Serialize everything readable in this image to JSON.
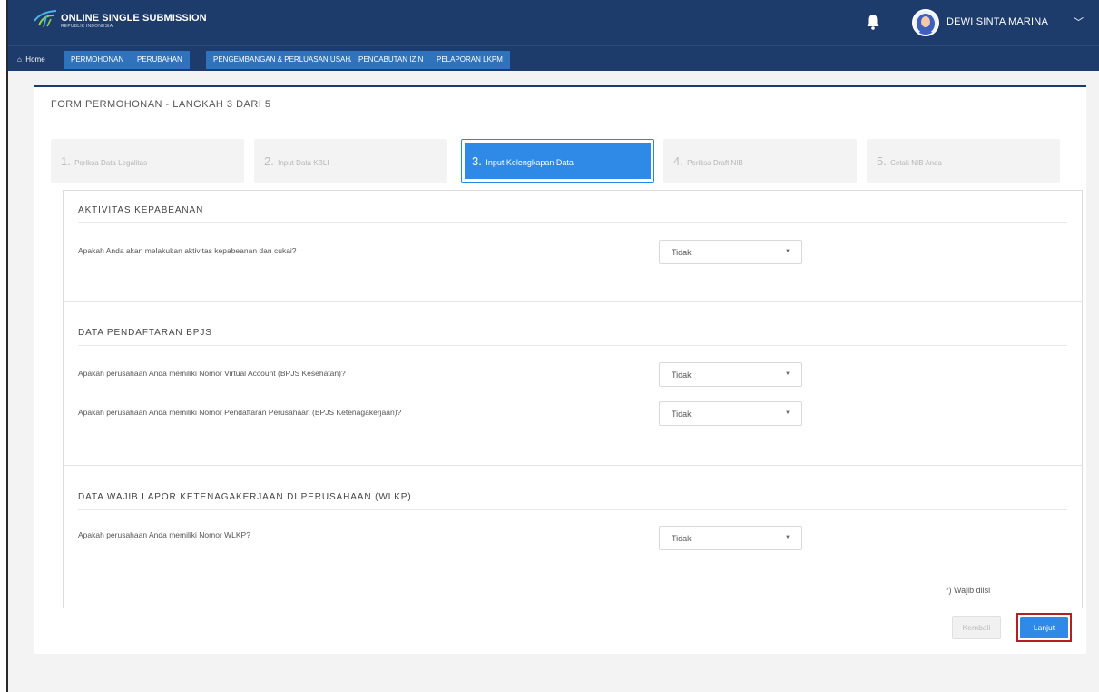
{
  "header": {
    "brand_title": "ONLINE SINGLE SUBMISSION",
    "brand_sub": "REPUBLIK INDONESIA",
    "user_name": "DEWI SINTA MARINA",
    "colors": {
      "primary": "#1d3b6b",
      "accent": "#2f89e6",
      "highlight": "#b41f24"
    }
  },
  "nav": {
    "home": "Home",
    "items": [
      "PERMOHONAN",
      "PERUBAHAN",
      "PENGEMBANGAN & PERLUASAN USAHA",
      "PENCABUTAN IZIN",
      "PELAPORAN LKPM"
    ]
  },
  "form": {
    "title": "FORM PERMOHONAN - LANGKAH 3 DARI 5",
    "steps": [
      {
        "num": "1.",
        "label": "Periksa Data Legalitas"
      },
      {
        "num": "2.",
        "label": "Input Data KBLI"
      },
      {
        "num": "3.",
        "label": "Input Kelengkapan Data"
      },
      {
        "num": "4.",
        "label": "Periksa Draft NIB"
      },
      {
        "num": "5.",
        "label": "Cetak NIB Anda"
      }
    ],
    "active_step": 3
  },
  "sections": [
    {
      "title": "AKTIVITAS KEPABEANAN",
      "questions": [
        {
          "label": "Apakah Anda akan melakukan aktivitas kepabeanan dan cukai?",
          "value": "Tidak"
        }
      ]
    },
    {
      "title": "DATA PENDAFTARAN BPJS",
      "questions": [
        {
          "label": "Apakah perusahaan Anda memiliki Nomor Virtual Account (BPJS Kesehatan)?",
          "value": "Tidak"
        },
        {
          "label": "Apakah perusahaan Anda memiliki Nomor Pendaftaran Perusahaan (BPJS Ketenagakerjaan)?",
          "value": "Tidak"
        }
      ]
    },
    {
      "title": "DATA WAJIB LAPOR KETENAGAKERJAAN DI PERUSAHAAN (WLKP)",
      "questions": [
        {
          "label": "Apakah perusahaan Anda memiliki Nomor WLKP?",
          "value": "Tidak"
        }
      ]
    }
  ],
  "footnote": "*) Wajib diisi",
  "buttons": {
    "back": "Kembali",
    "next": "Lanjut"
  }
}
